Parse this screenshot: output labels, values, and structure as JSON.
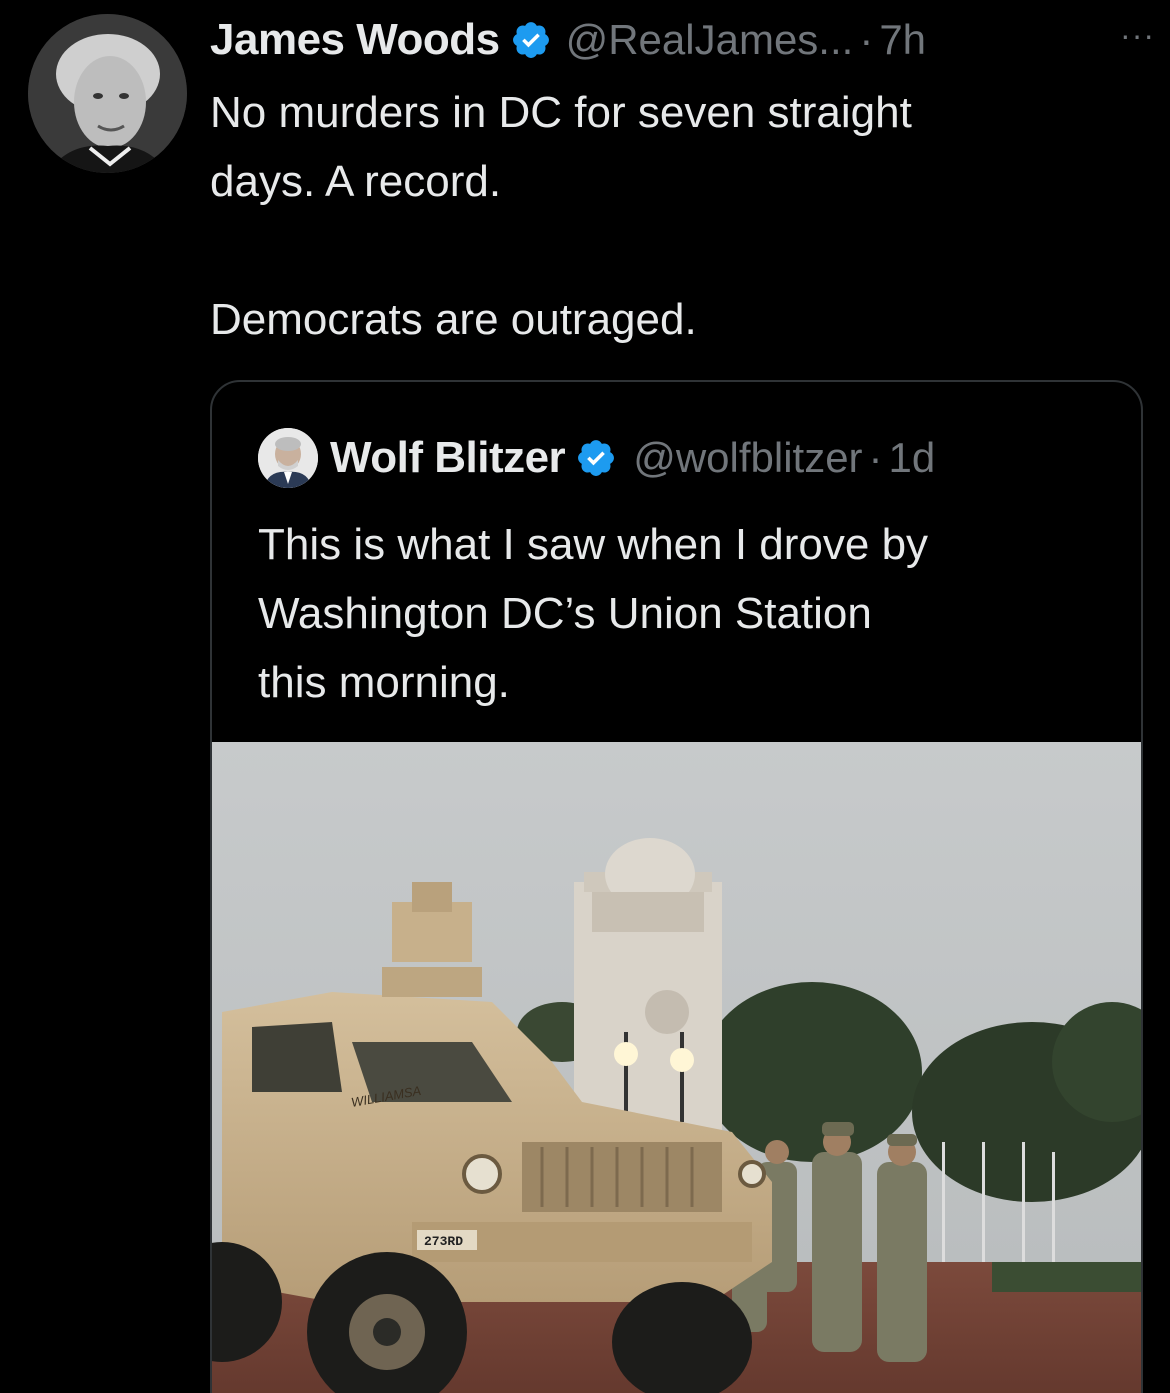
{
  "tweet": {
    "author_name": "James Woods",
    "handle": "@RealJames...",
    "separator": "·",
    "time": "7h",
    "more_label": "···",
    "verified_icon": "verified-badge-icon",
    "text_lines": [
      "No murders in DC for seven straight",
      "days. A record.",
      "Democrats are outraged."
    ]
  },
  "quote": {
    "author_name": "Wolf Blitzer",
    "handle": "@wolfblitzer",
    "separator": "·",
    "time": "1d",
    "verified_icon": "verified-badge-icon",
    "text_lines": [
      "This is what I saw when I drove by",
      "Washington DC’s Union Station",
      "this morning."
    ],
    "media": {
      "vehicle_plate": "273RD",
      "vehicle_side_text": "WILLIAMSA"
    }
  },
  "colors": {
    "background": "#000000",
    "text": "#e7e9ea",
    "secondary": "#71767b",
    "verified": "#1d9bf0",
    "border": "#2f3336"
  }
}
